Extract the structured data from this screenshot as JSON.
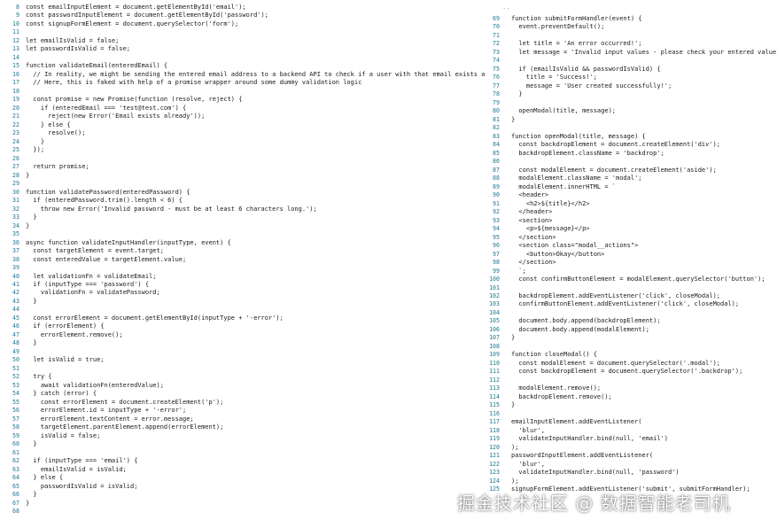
{
  "left_lines": [
    {
      "n": "8",
      "t": "const emailInputElement = document.getElementById('email');"
    },
    {
      "n": "9",
      "t": "const passwordInputElement = document.getElementById('password');"
    },
    {
      "n": "10",
      "t": "const signupFormElement = document.querySelector('form');"
    },
    {
      "n": "11",
      "t": ""
    },
    {
      "n": "12",
      "t": "let emailIsValid = false;"
    },
    {
      "n": "13",
      "t": "let passwordIsValid = false;"
    },
    {
      "n": "14",
      "t": ""
    },
    {
      "n": "15",
      "t": "function validateEmail(enteredEmail) {"
    },
    {
      "n": "16",
      "t": "  // In reality, we might be sending the entered email address to a backend API to check if a user with that email exists already"
    },
    {
      "n": "17",
      "t": "  // Here, this is faked with help of a promise wrapper around some dummy validation logic"
    },
    {
      "n": "18",
      "t": ""
    },
    {
      "n": "19",
      "t": "  const promise = new Promise(function (resolve, reject) {"
    },
    {
      "n": "20",
      "t": "    if (enteredEmail === 'test@test.com') {"
    },
    {
      "n": "21",
      "t": "      reject(new Error('Email exists already'));"
    },
    {
      "n": "22",
      "t": "    } else {"
    },
    {
      "n": "23",
      "t": "      resolve();"
    },
    {
      "n": "24",
      "t": "    }"
    },
    {
      "n": "25",
      "t": "  });"
    },
    {
      "n": "26",
      "t": ""
    },
    {
      "n": "27",
      "t": "  return promise;"
    },
    {
      "n": "28",
      "t": "}"
    },
    {
      "n": "29",
      "t": ""
    },
    {
      "n": "30",
      "t": "function validatePassword(enteredPassword) {"
    },
    {
      "n": "31",
      "t": "  if (enteredPassword.trim().length < 6) {"
    },
    {
      "n": "32",
      "t": "    throw new Error('Invalid password - must be at least 6 characters long.');"
    },
    {
      "n": "33",
      "t": "  }"
    },
    {
      "n": "34",
      "t": "}"
    },
    {
      "n": "35",
      "t": ""
    },
    {
      "n": "36",
      "t": "async function validateInputHandler(inputType, event) {"
    },
    {
      "n": "37",
      "t": "  const targetElement = event.target;"
    },
    {
      "n": "38",
      "t": "  const enteredValue = targetElement.value;"
    },
    {
      "n": "39",
      "t": ""
    },
    {
      "n": "40",
      "t": "  let validationFn = validateEmail;"
    },
    {
      "n": "41",
      "t": "  if (inputType === 'password') {"
    },
    {
      "n": "42",
      "t": "    validationFn = validatePassword;"
    },
    {
      "n": "43",
      "t": "  }"
    },
    {
      "n": "44",
      "t": ""
    },
    {
      "n": "45",
      "t": "  const errorElement = document.getElementById(inputType + '-error');"
    },
    {
      "n": "46",
      "t": "  if (errorElement) {"
    },
    {
      "n": "47",
      "t": "    errorElement.remove();"
    },
    {
      "n": "48",
      "t": "  }"
    },
    {
      "n": "49",
      "t": ""
    },
    {
      "n": "50",
      "t": "  let isValid = true;"
    },
    {
      "n": "51",
      "t": ""
    },
    {
      "n": "52",
      "t": "  try {"
    },
    {
      "n": "53",
      "t": "    await validationFn(enteredValue);"
    },
    {
      "n": "54",
      "t": "  } catch (error) {"
    },
    {
      "n": "55",
      "t": "    const errorElement = document.createElement('p');"
    },
    {
      "n": "56",
      "t": "    errorElement.id = inputType + '-error';"
    },
    {
      "n": "57",
      "t": "    errorElement.textContent = error.message;"
    },
    {
      "n": "58",
      "t": "    targetElement.parentElement.append(errorElement);"
    },
    {
      "n": "59",
      "t": "    isValid = false;"
    },
    {
      "n": "60",
      "t": "  }"
    },
    {
      "n": "61",
      "t": ""
    },
    {
      "n": "62",
      "t": "  if (inputType === 'email') {"
    },
    {
      "n": "63",
      "t": "    emailIsValid = isValid;"
    },
    {
      "n": "64",
      "t": "  } else {"
    },
    {
      "n": "65",
      "t": "    passwordIsValid = isValid;"
    },
    {
      "n": "66",
      "t": "  }"
    },
    {
      "n": "67",
      "t": "}"
    },
    {
      "n": "68",
      "t": ""
    }
  ],
  "right_ellipsis": "..",
  "right_lines": [
    {
      "n": "69",
      "t": "function submitFormHandler(event) {"
    },
    {
      "n": "70",
      "t": "  event.preventDefault();"
    },
    {
      "n": "71",
      "t": ""
    },
    {
      "n": "72",
      "t": "  let title = 'An error occurred!';"
    },
    {
      "n": "73",
      "t": "  let message = 'Invalid input values - please check your entered values.';"
    },
    {
      "n": "74",
      "t": ""
    },
    {
      "n": "75",
      "t": "  if (emailIsValid && passwordIsValid) {"
    },
    {
      "n": "76",
      "t": "    title = 'Success!';"
    },
    {
      "n": "77",
      "t": "    message = 'User created successfully!';"
    },
    {
      "n": "78",
      "t": "  }"
    },
    {
      "n": "79",
      "t": ""
    },
    {
      "n": "80",
      "t": "  openModal(title, message);"
    },
    {
      "n": "81",
      "t": "}"
    },
    {
      "n": "82",
      "t": ""
    },
    {
      "n": "83",
      "t": "function openModal(title, message) {"
    },
    {
      "n": "84",
      "t": "  const backdropElement = document.createElement('div');"
    },
    {
      "n": "85",
      "t": "  backdropElement.className = 'backdrop';"
    },
    {
      "n": "86",
      "t": ""
    },
    {
      "n": "87",
      "t": "  const modalElement = document.createElement('aside');"
    },
    {
      "n": "88",
      "t": "  modalElement.className = 'modal';"
    },
    {
      "n": "89",
      "t": "  modalElement.innerHTML = `"
    },
    {
      "n": "90",
      "t": "  <header>"
    },
    {
      "n": "91",
      "t": "    <h2>${title}</h2>"
    },
    {
      "n": "92",
      "t": "  </header>"
    },
    {
      "n": "93",
      "t": "  <section>"
    },
    {
      "n": "94",
      "t": "    <p>${message}</p>"
    },
    {
      "n": "95",
      "t": "  </section>"
    },
    {
      "n": "96",
      "t": "  <section class=\"modal__actions\">"
    },
    {
      "n": "97",
      "t": "    <button>Okay</button>"
    },
    {
      "n": "98",
      "t": "  </section>"
    },
    {
      "n": "99",
      "t": "  `;"
    },
    {
      "n": "100",
      "t": "  const confirmButtonElement = modalElement.querySelector('button');"
    },
    {
      "n": "101",
      "t": ""
    },
    {
      "n": "102",
      "t": "  backdropElement.addEventListener('click', closeModal);"
    },
    {
      "n": "103",
      "t": "  confirmButtonElement.addEventListener('click', closeModal);"
    },
    {
      "n": "104",
      "t": ""
    },
    {
      "n": "105",
      "t": "  document.body.append(backdropElement);"
    },
    {
      "n": "106",
      "t": "  document.body.append(modalElement);"
    },
    {
      "n": "107",
      "t": "}"
    },
    {
      "n": "108",
      "t": ""
    },
    {
      "n": "109",
      "t": "function closeModal() {"
    },
    {
      "n": "110",
      "t": "  const modalElement = document.querySelector('.modal');"
    },
    {
      "n": "111",
      "t": "  const backdropElement = document.querySelector('.backdrop');"
    },
    {
      "n": "112",
      "t": ""
    },
    {
      "n": "113",
      "t": "  modalElement.remove();"
    },
    {
      "n": "114",
      "t": "  backdropElement.remove();"
    },
    {
      "n": "115",
      "t": "}"
    },
    {
      "n": "116",
      "t": ""
    },
    {
      "n": "117",
      "t": "emailInputElement.addEventListener("
    },
    {
      "n": "118",
      "t": "  'blur',"
    },
    {
      "n": "119",
      "t": "  validateInputHandler.bind(null, 'email')"
    },
    {
      "n": "120",
      "t": ");"
    },
    {
      "n": "121",
      "t": "passwordInputElement.addEventListener("
    },
    {
      "n": "122",
      "t": "  'blur',"
    },
    {
      "n": "123",
      "t": "  validateInputHandler.bind(null, 'password')"
    },
    {
      "n": "124",
      "t": ");"
    },
    {
      "n": "125",
      "t": "signupFormElement.addEventListener('submit', submitFormHandler);"
    }
  ],
  "watermark": "掘金技术社区 @ 数据智能老司机"
}
